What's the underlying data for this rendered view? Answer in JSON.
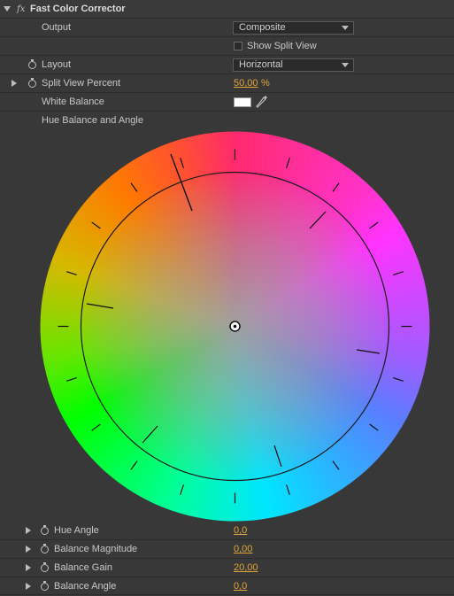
{
  "header": {
    "title": "Fast Color Corrector",
    "fx_label": "fx"
  },
  "output": {
    "label": "Output",
    "value": "Composite"
  },
  "split_view": {
    "label": "Show Split View",
    "checked": false
  },
  "layout": {
    "label": "Layout",
    "value": "Horizontal"
  },
  "split_percent": {
    "label": "Split View Percent",
    "value": "50,00",
    "unit": "%"
  },
  "white_balance": {
    "label": "White Balance",
    "color": "#ffffff"
  },
  "hue_wheel": {
    "label": "Hue Balance and Angle"
  },
  "params": [
    {
      "label": "Hue Angle",
      "value": "0,0"
    },
    {
      "label": "Balance Magnitude",
      "value": "0,00"
    },
    {
      "label": "Balance Gain",
      "value": "20,00"
    },
    {
      "label": "Balance Angle",
      "value": "0,0"
    }
  ],
  "colors": {
    "value_accent": "#e0a63a",
    "panel_bg": "#383838",
    "text": "#c8c8c8"
  },
  "icons": [
    "triangle-down-icon",
    "fx-icon",
    "stopwatch-icon",
    "triangle-right-icon",
    "dropdown-arrow-icon",
    "eyedropper-icon"
  ]
}
